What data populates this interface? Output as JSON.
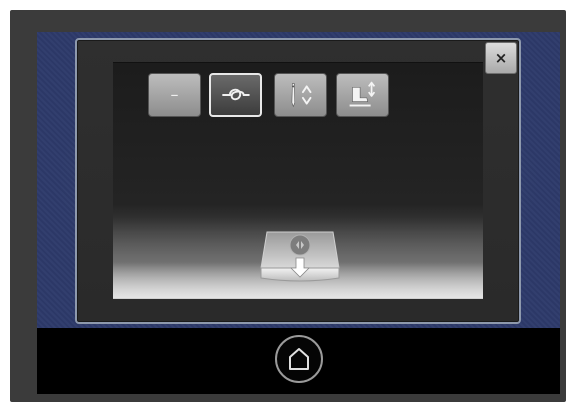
{
  "toolbar": {
    "buttons": [
      {
        "id": "single",
        "label": "–",
        "icon": "dash-icon",
        "active": false
      },
      {
        "id": "tie-off",
        "label": "",
        "icon": "knot-icon",
        "active": true
      },
      {
        "id": "needle-stop",
        "label": "",
        "icon": "needle-up-down-icon",
        "active": false
      },
      {
        "id": "presser-foot",
        "label": "",
        "icon": "presser-foot-icon",
        "active": false
      }
    ]
  },
  "dialog": {
    "close_label": "×"
  },
  "tray": {
    "icon": "save-to-tray-icon"
  },
  "nav": {
    "home_icon": "home-icon"
  },
  "colors": {
    "screen_bg": "#2d3a6a",
    "dialog_border": "#8e99ad",
    "button_face": "#a8a8a8",
    "active_border": "#e8e8e8"
  }
}
